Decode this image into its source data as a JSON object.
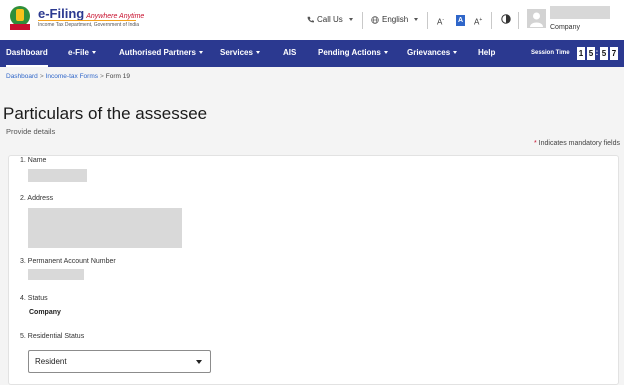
{
  "header": {
    "brand": "e-Filing",
    "tagline": "Anywhere Anytime",
    "department": "Income Tax Department, Government of India",
    "call_us": "Call Us",
    "language": "English",
    "font_decrease": "A",
    "font_normal": "A",
    "font_increase": "A",
    "user_role": "Company"
  },
  "nav": {
    "items": [
      {
        "label": "Dashboard",
        "active": true
      },
      {
        "label": "e-File",
        "dropdown": true
      },
      {
        "label": "Authorised Partners",
        "dropdown": true
      },
      {
        "label": "Services",
        "dropdown": true
      },
      {
        "label": "AIS"
      },
      {
        "label": "Pending Actions",
        "dropdown": true
      },
      {
        "label": "Grievances",
        "dropdown": true
      },
      {
        "label": "Help"
      }
    ],
    "session_label": "Session Time",
    "session_digits": [
      "1",
      "5",
      "5",
      "7"
    ]
  },
  "breadcrumb": [
    "Dashboard",
    "Income-tax Forms",
    "Form 19"
  ],
  "page": {
    "title": "Particulars of the assessee",
    "subtitle": "Provide details",
    "mandatory_star": "*",
    "mandatory_note": "Indicates mandatory fields"
  },
  "form": {
    "name_label": "1. Name",
    "address_label": "2. Address",
    "pan_label": "3. Permanent Account Number",
    "status_label": "4. Status",
    "status_value": "Company",
    "residential_label": "5. Residential Status",
    "residential_value": "Resident"
  },
  "colors": {
    "nav_bg": "#2b3990",
    "link": "#2f66c9",
    "required": "#c8102e"
  }
}
